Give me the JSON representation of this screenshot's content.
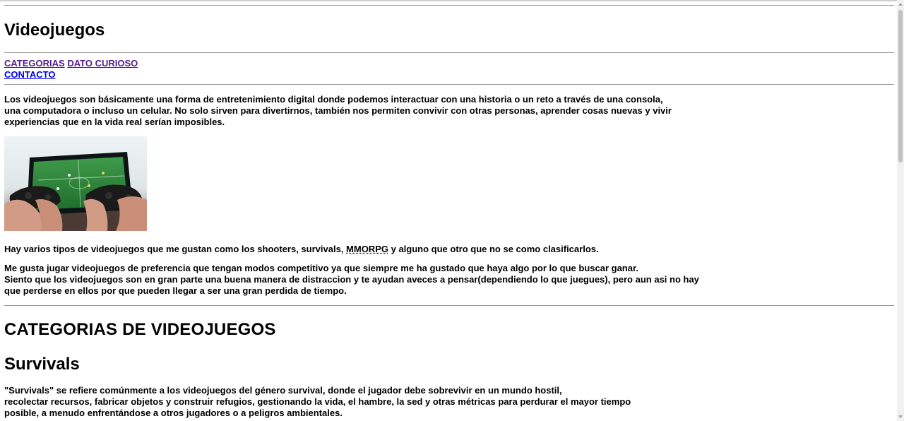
{
  "header": {
    "title": "Videojuegos"
  },
  "nav": {
    "categorias": "CATEGORIAS",
    "dato_curioso": "DATO CURIOSO",
    "contacto": "CONTACTO"
  },
  "intro": {
    "line1": "Los videojuegos son básicamente una forma de entretenimiento digital donde podemos interactuar con una historia o un reto a través de una consola,",
    "line2": "una computadora o incluso un celular. No solo sirven para divertirnos, también nos permiten convivir con otras personas, aprender cosas nuevas y vivir",
    "line3": "experiencias que en la vida real serían imposibles."
  },
  "image": {
    "subject": "game-controllers-in-front-of-tv"
  },
  "tipos": {
    "before": "Hay varios tipos de videojuegos que me gustan como los shooters, survivals, ",
    "abbr": "MMORPG",
    "after": " y alguno que otro que no se como clasificarlos."
  },
  "preferencia": {
    "line1": "Me gusta jugar videojuegos de preferencia que tengan modos competitivo ya que siempre me ha gustado que haya algo por lo que buscar ganar.",
    "line2": "Siento que los videojuegos son en gran parte una buena manera de distraccion y te ayudan aveces a pensar(dependiendo lo que juegues), pero aun asi no hay",
    "line3": "que perderse en ellos por que pueden llegar a ser una gran perdida de tiempo."
  },
  "categorias": {
    "title": "CATEGORIAS DE VIDEOJUEGOS"
  },
  "survivals": {
    "title": "Survivals",
    "line1": "\"Survivals\" se refiere comúnmente a los videojuegos del género survival, donde el jugador debe sobrevivir en un mundo hostil,",
    "line2": "recolectar recursos, fabricar objetos y construir refugios, gestionando la vida, el hambre, la sed y otras métricas para perdurar el mayor tiempo",
    "line3": "posible, a menudo enfrentándose a otros jugadores o a peligros ambientales."
  }
}
